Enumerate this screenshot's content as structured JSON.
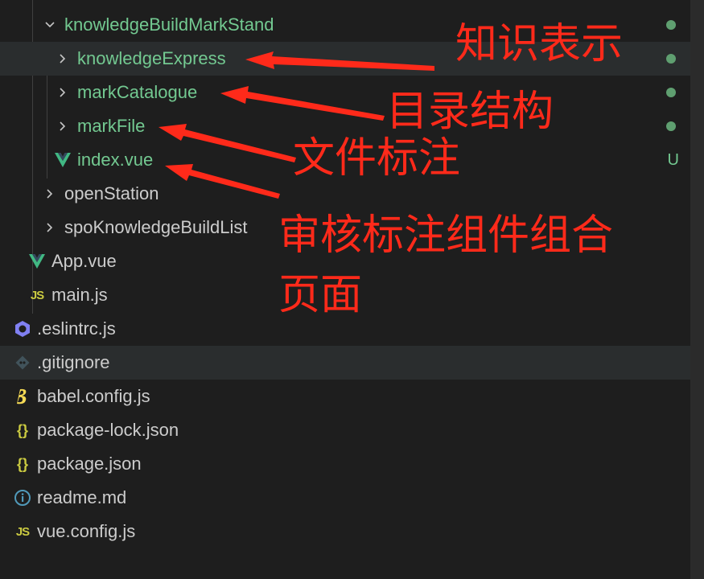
{
  "tree": {
    "items": [
      {
        "label": "knowledgeBuildMarkStand",
        "status": "dot"
      },
      {
        "label": "knowledgeExpress",
        "status": "dot"
      },
      {
        "label": "markCatalogue",
        "status": "dot"
      },
      {
        "label": "markFile",
        "status": "dot"
      },
      {
        "label": "index.vue",
        "status": "U"
      },
      {
        "label": "openStation"
      },
      {
        "label": "spoKnowledgeBuildList"
      },
      {
        "label": "App.vue"
      },
      {
        "label": "main.js"
      },
      {
        "label": ".eslintrc.js"
      },
      {
        "label": ".gitignore"
      },
      {
        "label": "babel.config.js"
      },
      {
        "label": "package-lock.json"
      },
      {
        "label": "package.json"
      },
      {
        "label": "readme.md"
      },
      {
        "label": "vue.config.js"
      }
    ]
  },
  "icons": {
    "js_text": "JS",
    "json_text": "{}"
  },
  "annotations": {
    "knowledge_express": "知识表示",
    "catalogue": "目录结构",
    "file_mark": "文件标注",
    "combo_line1": "审核标注组件组合",
    "combo_line2": "页面"
  },
  "colors": {
    "modified_green": "#73c991",
    "annotation_red": "#ff2a1a",
    "vue_green": "#41b883",
    "js_yellow": "#cbcb41"
  }
}
